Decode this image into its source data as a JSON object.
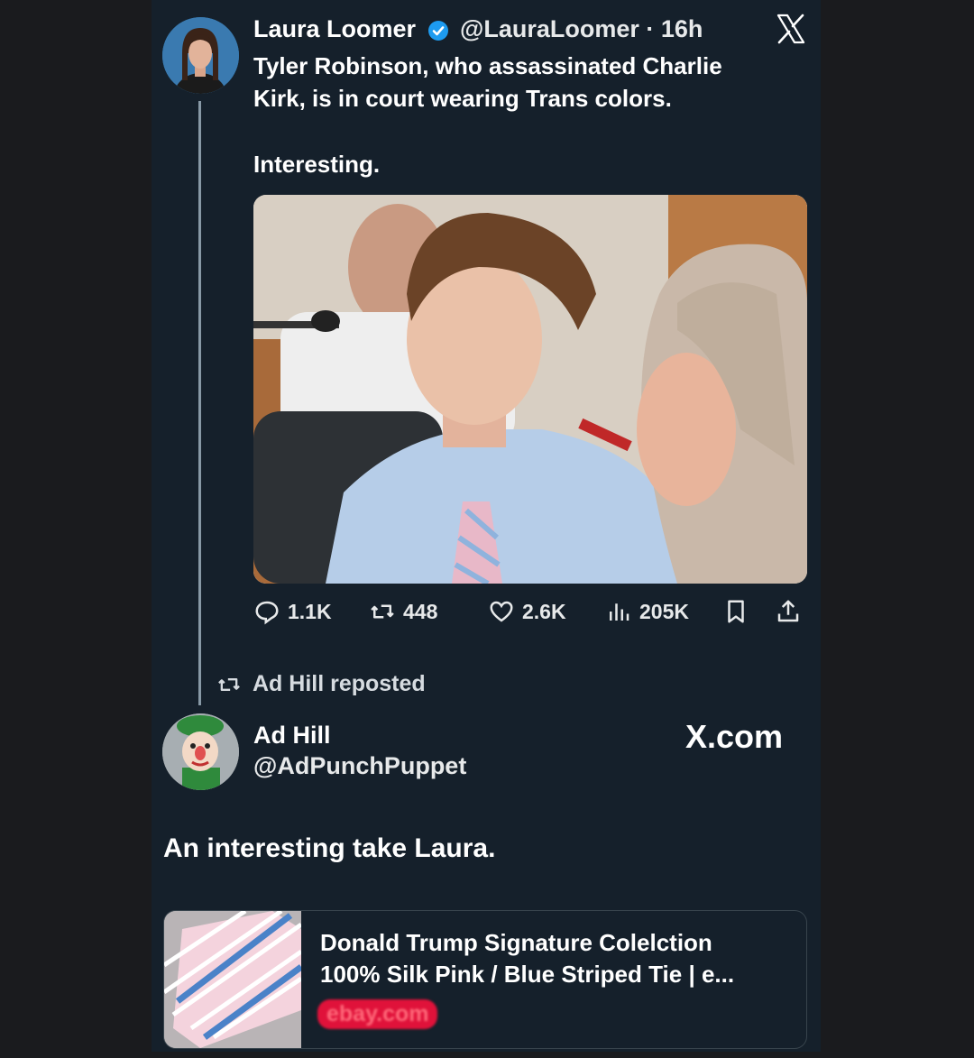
{
  "tweet": {
    "author_name": "Laura Loomer",
    "handle_time": "@LauraLoomer · 16h",
    "text_line1": "Tyler Robinson, who assassinated Charlie",
    "text_line2": "Kirk, is in court wearing Trans colors.",
    "text_line3": "Interesting.",
    "stats": {
      "replies": "1.1K",
      "reposts": "448",
      "likes": "2.6K",
      "views": "205K"
    }
  },
  "repost": {
    "label": "Ad Hill reposted"
  },
  "reply": {
    "author_name": "Ad Hill",
    "handle": "@AdPunchPuppet",
    "watermark": "X.com",
    "text": "An interesting take Laura."
  },
  "link_card": {
    "title_line1": "Donald Trump Signature Colelction",
    "title_line2": "100% Silk Pink / Blue Striped Tie | e...",
    "domain": "ebay.com"
  },
  "colors": {
    "panel": "#15202b",
    "outer": "#1a1b1e",
    "verified": "#1d9bf0",
    "domain_highlight": "#e0123a"
  }
}
